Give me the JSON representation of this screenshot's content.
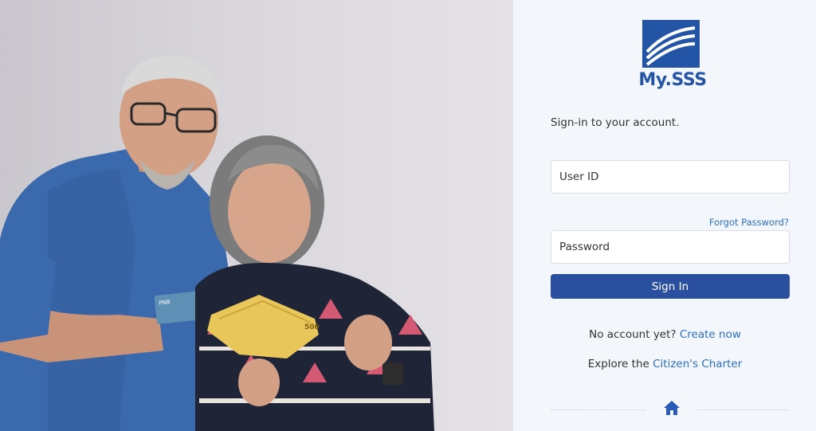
{
  "brand": {
    "logo_text": "My.SSS",
    "logo_color": "#2454a6"
  },
  "signin": {
    "subtitle": "Sign-in to your account.",
    "user_placeholder": "User ID",
    "forgot_label": "Forgot Password?",
    "password_placeholder": "Password",
    "button_label": "Sign In",
    "button_color": "#2a4f9f"
  },
  "footer_links": {
    "no_account_text": "No account yet? ",
    "create_label": "Create now",
    "explore_text": "Explore the ",
    "charter_label": "Citizen's Charter"
  },
  "icons": {
    "home": "home-icon"
  },
  "hero": {
    "card_label": "PNB",
    "banknote_label": "500"
  }
}
